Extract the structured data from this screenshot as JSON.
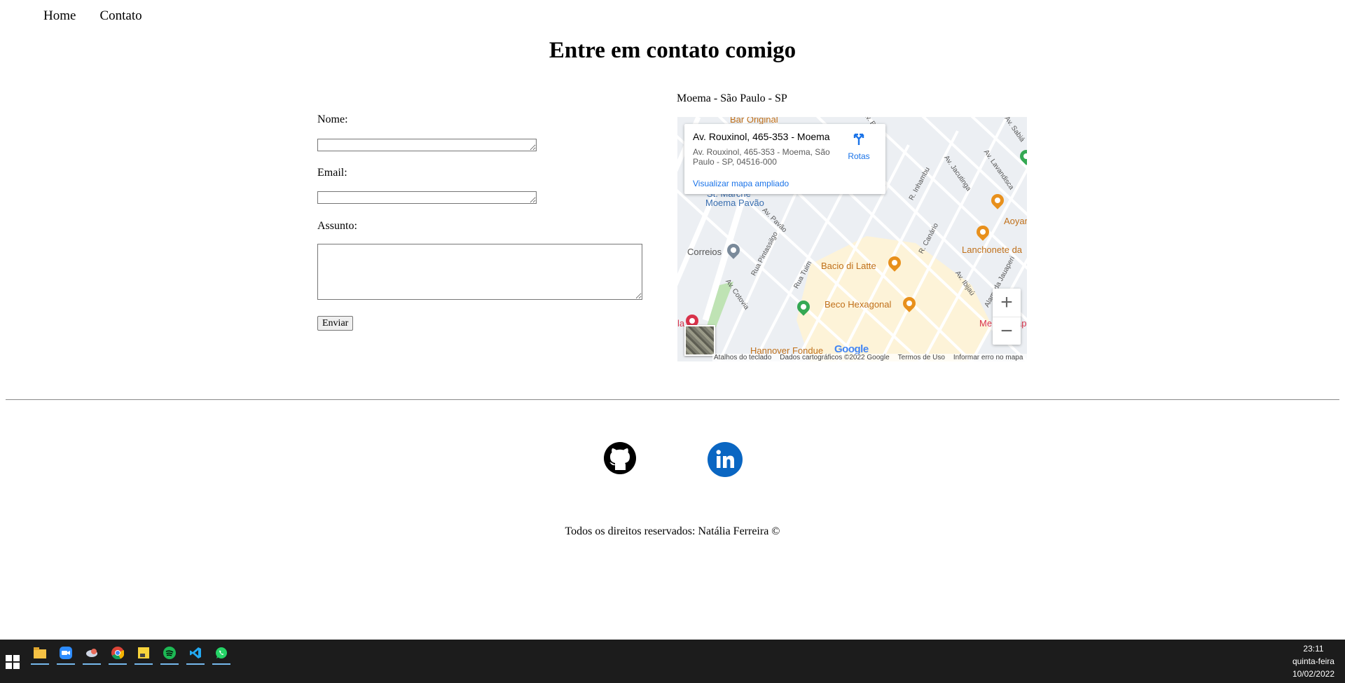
{
  "nav": {
    "home": "Home",
    "contact": "Contato"
  },
  "page_title": "Entre em contato comigo",
  "form": {
    "name_label": "Nome:",
    "email_label": "Email:",
    "subject_label": "Assunto:",
    "name_value": "",
    "email_value": "",
    "subject_value": "",
    "submit_label": "Enviar"
  },
  "map": {
    "caption": "Moema - São Paulo - SP",
    "info": {
      "title": "Av. Rouxinol, 465-353 - Moema",
      "address": "Av. Rouxinol, 465-353 - Moema, São Paulo - SP, 04516-000",
      "route_label": "Rotas",
      "larger_map_link": "Visualizar mapa ampliado"
    },
    "pois": {
      "bar_original": "Bar Original",
      "st_marche": "St. Marche",
      "moema_pavao": "Moema Pavão",
      "correios": "Correios",
      "bacio_di_latte": "Bacio di Latte",
      "beco_hexagonal": "Beco Hexagonal",
      "hannover_fondue": "Hannover Fondue",
      "lanchonete": "Lanchonete da",
      "aoyama": "Aoyar",
      "moema_partial": "Me",
      "ap_partial": "ap",
      "la_partial": "la"
    },
    "streets": {
      "av_pavao": "Av. Pavão",
      "rua_pintassilgo": "Rua Pintassilgo",
      "av_cotovia": "Av. Cotovia",
      "rua_tuim": "Rua Tuim",
      "r_inhambu": "R. Inhambu",
      "av_jacutinga": "Av. Jacutinga",
      "av_lavandisca": "Av. Lavandisca",
      "av_sabia": "Av. Sabiá",
      "r_canario": "R. Canário",
      "av_ibijau": "Av. Ibijaú",
      "alameda_jauaperi": "Alameda Jauaperi",
      "av_borba": "Av. Borba"
    },
    "zoom_in": "+",
    "zoom_out": "−",
    "google_logo": "Google",
    "attribution": {
      "keyboard": "Atalhos do teclado",
      "data": "Dados cartográficos ©2022 Google",
      "terms": "Termos de Uso",
      "report": "Informar erro no mapa"
    }
  },
  "footer": {
    "github_icon": "github-icon",
    "linkedin_icon": "linkedin-icon",
    "copyright": "Todos os direitos reservados: Natália Ferreira ©"
  },
  "taskbar": {
    "apps": [
      "file-explorer-icon",
      "zoom-icon",
      "app-icon",
      "chrome-icon",
      "sticky-notes-icon",
      "spotify-icon",
      "vscode-icon",
      "whatsapp-icon"
    ],
    "time": "23:11",
    "day": "quinta-feira",
    "date": "10/02/2022"
  },
  "colors": {
    "linkedin": "#0a66c2",
    "taskbar": "#1c1c1c",
    "map_link": "#1a73e8",
    "poi_orange": "#e8901c",
    "poi_green": "#34a853"
  }
}
